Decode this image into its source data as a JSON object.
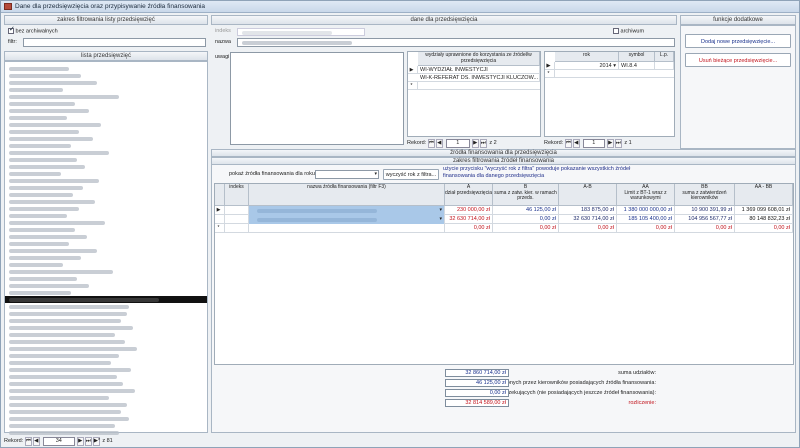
{
  "window": {
    "title": "Dane dla przedsięwzięcia oraz przypisywanie źródła finansowania"
  },
  "left": {
    "filters_header": "zakres filtrowania listy przedsięwzięć",
    "archive_checkbox_label": "bez archiwalnych",
    "archive_checked": true,
    "filter_label": "filtr:",
    "filter_value": "",
    "list_header": "lista przedsięwzięć",
    "record_label": "Rekord:",
    "record_value": "34",
    "record_total": "z 81"
  },
  "center": {
    "header": "dane dla przedsięwzięcia",
    "index_label": "indeks",
    "name_label": "nazwa",
    "archive_label": "archiwum",
    "notes_label": "uwagi",
    "depts_header": "wydziały uprawnione do korzystania ze źródeł/w przedsięwzięcia",
    "depts": [
      "WI-WYDZIAŁ INWESTYCJI",
      "WI-K-REFERAT DS. INWESTYCJI KLUCZOW..."
    ],
    "depts_record": "1",
    "year_col": "rok",
    "symbol_col": "symbol",
    "lp_col": "L.p.",
    "years": [
      {
        "rok": "2014",
        "symbol": "WI.8.4",
        "lp": ""
      }
    ],
    "years_record": "1",
    "record_label": "Rekord:",
    "record_total": "z",
    "record_total_depts": "z 2",
    "record_total_years": "z 1"
  },
  "right": {
    "header": "funkcje dodatkowe",
    "add_button": "Dodaj nowe przedsięwzięcie...",
    "delete_button": "Usuń bieżące przedsięwzięcie..."
  },
  "sources": {
    "header": "źródła finansowania dla przedsięwzięcia",
    "filter_header": "zakres filtrowania źródeł finansowania",
    "show_label": "pokaż źródła finansowania dla roku:",
    "clear_button": "wyczyść rok z filtra...",
    "hint": "użycie przycisku \"wyczyść rok z filtra\" powoduje pokazanie wszystkich źródeł finansowania dla danego przedsięwzięcia",
    "columns": [
      {
        "name": "indeks"
      },
      {
        "name": "nazwa źródła finansowania (filtr F3)"
      },
      {
        "name": "A",
        "sub": "dział przedsięwzięcia"
      },
      {
        "name": "B",
        "sub": "suma z zatw. kier. w ramach przeds."
      },
      {
        "name": "A-B"
      },
      {
        "name": "AA",
        "sub": "Limit z BT-1 wraz z warunkowymi"
      },
      {
        "name": "BB",
        "sub": "suma z zatwierdzeń kierowników"
      },
      {
        "name": "AA - BB"
      }
    ],
    "rows": [
      {
        "a": "230 000,00 zł",
        "b": "46 125,00 zł",
        "ab": "183 875,00 zł",
        "aa": "1 380 000 000,00 zł",
        "bb": "10 900 391,99 zł",
        "aabb": "1 369 099 608,01 zł"
      },
      {
        "a": "32 630 714,00 zł",
        "b": "0,00 zł",
        "ab": "32 630 714,00 zł",
        "aa": "185 105 400,00 zł",
        "bb": "104 956 567,77 zł",
        "aabb": "80 148 832,23 zł"
      },
      {
        "a": "0,00 zł",
        "b": "0,00 zł",
        "ab": "0,00 zł",
        "aa": "0,00 zł",
        "bb": "0,00 zł",
        "aabb": "0,00 zł"
      }
    ],
    "summary": [
      {
        "label": "suma udziałów:",
        "value": "32 860 714,00 zł"
      },
      {
        "label": "suma z zatwierdzonych przez kierowników posiadających źródła finansowania:",
        "value": "46 125,00 zł"
      },
      {
        "label": "suma wniosków oczekujących (nie posiadających jeszcze źródeł finansowania):",
        "value": "0,00 zł"
      },
      {
        "label": "rozliczenie:",
        "value": "32 814 589,00 zł"
      }
    ]
  }
}
